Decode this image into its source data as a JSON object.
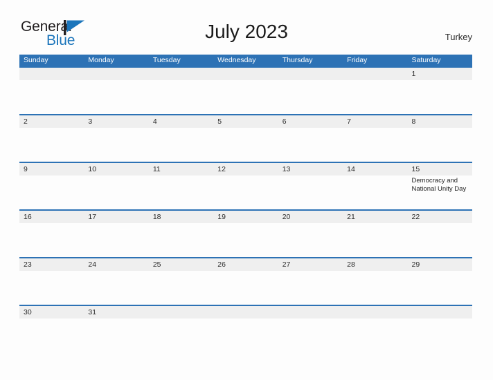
{
  "brand": {
    "word_one": "General",
    "word_two": "Blue",
    "flag_icon": "blue-flag-triangle-icon",
    "color_dark": "#231f20",
    "color_blue": "#1b75bb"
  },
  "header": {
    "title": "July 2023",
    "country": "Turkey"
  },
  "calendar": {
    "header_color": "#2d72b5",
    "date_band_color": "#efefef",
    "weekdays": [
      "Sunday",
      "Monday",
      "Tuesday",
      "Wednesday",
      "Thursday",
      "Friday",
      "Saturday"
    ],
    "weeks": [
      {
        "days": [
          {
            "date": "",
            "event": ""
          },
          {
            "date": "",
            "event": ""
          },
          {
            "date": "",
            "event": ""
          },
          {
            "date": "",
            "event": ""
          },
          {
            "date": "",
            "event": ""
          },
          {
            "date": "",
            "event": ""
          },
          {
            "date": "1",
            "event": ""
          }
        ]
      },
      {
        "days": [
          {
            "date": "2",
            "event": ""
          },
          {
            "date": "3",
            "event": ""
          },
          {
            "date": "4",
            "event": ""
          },
          {
            "date": "5",
            "event": ""
          },
          {
            "date": "6",
            "event": ""
          },
          {
            "date": "7",
            "event": ""
          },
          {
            "date": "8",
            "event": ""
          }
        ]
      },
      {
        "days": [
          {
            "date": "9",
            "event": ""
          },
          {
            "date": "10",
            "event": ""
          },
          {
            "date": "11",
            "event": ""
          },
          {
            "date": "12",
            "event": ""
          },
          {
            "date": "13",
            "event": ""
          },
          {
            "date": "14",
            "event": ""
          },
          {
            "date": "15",
            "event": "Democracy and National Unity Day"
          }
        ]
      },
      {
        "days": [
          {
            "date": "16",
            "event": ""
          },
          {
            "date": "17",
            "event": ""
          },
          {
            "date": "18",
            "event": ""
          },
          {
            "date": "19",
            "event": ""
          },
          {
            "date": "20",
            "event": ""
          },
          {
            "date": "21",
            "event": ""
          },
          {
            "date": "22",
            "event": ""
          }
        ]
      },
      {
        "days": [
          {
            "date": "23",
            "event": ""
          },
          {
            "date": "24",
            "event": ""
          },
          {
            "date": "25",
            "event": ""
          },
          {
            "date": "26",
            "event": ""
          },
          {
            "date": "27",
            "event": ""
          },
          {
            "date": "28",
            "event": ""
          },
          {
            "date": "29",
            "event": ""
          }
        ]
      },
      {
        "days": [
          {
            "date": "30",
            "event": ""
          },
          {
            "date": "31",
            "event": ""
          },
          {
            "date": "",
            "event": ""
          },
          {
            "date": "",
            "event": ""
          },
          {
            "date": "",
            "event": ""
          },
          {
            "date": "",
            "event": ""
          },
          {
            "date": "",
            "event": ""
          }
        ]
      }
    ]
  }
}
